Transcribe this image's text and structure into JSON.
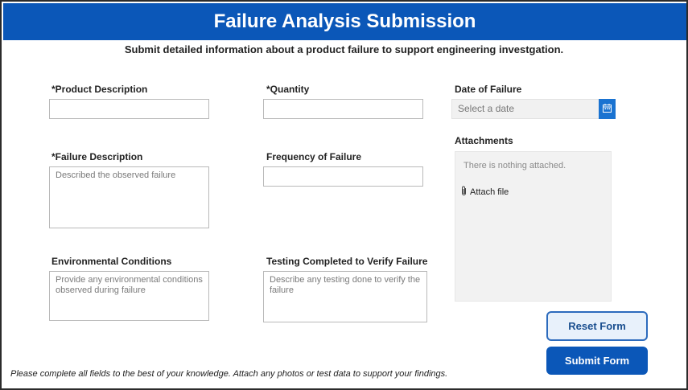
{
  "header": {
    "title": "Failure Analysis Submission"
  },
  "subtitle": "Submit detailed information about a product failure to support engineering investgation.",
  "fields": {
    "product_description": {
      "label": "*Product Description",
      "value": ""
    },
    "quantity": {
      "label": "*Quantity",
      "value": ""
    },
    "date_of_failure": {
      "label": "Date of Failure",
      "placeholder": "Select a date"
    },
    "failure_description": {
      "label": "*Failure Description",
      "placeholder": "Described the observed failure"
    },
    "frequency_of_failure": {
      "label": "Frequency of Failure",
      "value": ""
    },
    "environmental_conditions": {
      "label": "Environmental Conditions",
      "placeholder": "Provide any environmental conditions observed during failure"
    },
    "testing_completed": {
      "label": "Testing Completed to Verify Failure",
      "placeholder": "Describe any testing done to verify the failure"
    }
  },
  "attachments": {
    "label": "Attachments",
    "empty_text": "There is nothing attached.",
    "attach_label": "Attach file"
  },
  "buttons": {
    "reset": "Reset Form",
    "submit": "Submit Form"
  },
  "footer": "Please complete all fields to the best of your knowledge. Attach any photos or test data to support your findings.",
  "colors": {
    "header_bg": "#0b57b8",
    "accent": "#1a73d1",
    "reset_bg": "#e8f1fb"
  },
  "icons": {
    "date_picker": "calendar-icon",
    "attach": "paperclip-icon"
  }
}
